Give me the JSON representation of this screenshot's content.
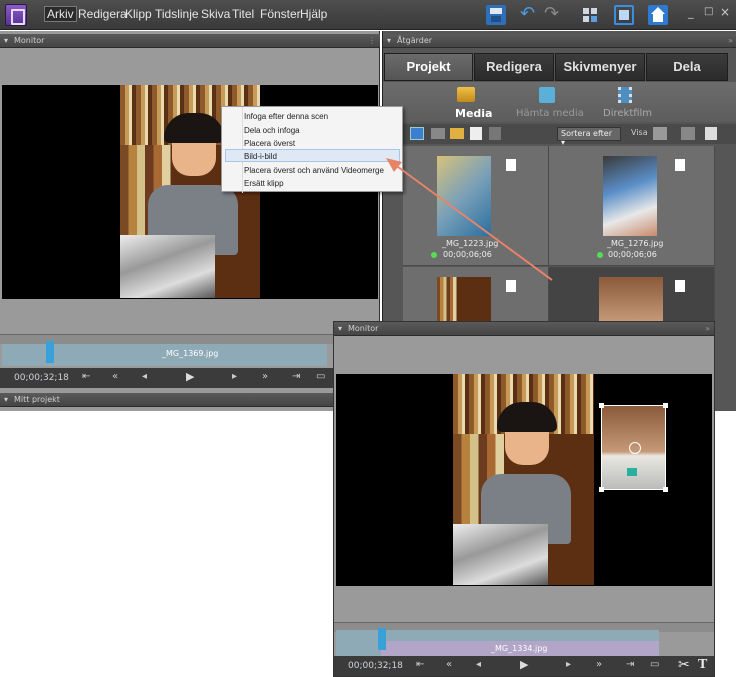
{
  "menu": [
    "Arkiv",
    "Redigera",
    "Klipp",
    "Tidslinje",
    "Skiva",
    "Titel",
    "Fönster",
    "Hjälp"
  ],
  "window_controls": [
    "_",
    "□",
    "×"
  ],
  "monitor_panel": {
    "title": "Monitor",
    "timecode": "00;00;32;18",
    "clip_name": "_MG_1369.jpg"
  },
  "my_project": {
    "title": "Mitt projekt"
  },
  "actions_panel": {
    "title": "Åtgärder",
    "tabs": [
      "Projekt",
      "Redigera",
      "Skivmenyer",
      "Dela"
    ],
    "sub_buttons": [
      "Media",
      "Hämta media",
      "Direktfilm"
    ],
    "sort_label": "Sortera efter",
    "view_label": "Visa",
    "clips": [
      {
        "name": "_MG_1223.jpg",
        "duration": "00;00;06;06"
      },
      {
        "name": "_MG_1276.jpg",
        "duration": "00;00;06;06"
      }
    ]
  },
  "context_menu": {
    "items": [
      "Infoga efter denna scen",
      "Dela och infoga",
      "Placera överst",
      "Bild-i-bild",
      "Placera överst och använd Videomerge",
      "Ersätt klipp"
    ],
    "highlighted": "Bild-i-bild"
  },
  "monitor2": {
    "title": "Monitor",
    "timecode": "00;00;32;18",
    "clip_name": "_MG_1334.jpg"
  },
  "colors": {
    "accent_tab": "#5a5a5a",
    "arrow": "#e8836a",
    "app_icon": "#7a4fb8",
    "timeline": "#8eaab6"
  }
}
